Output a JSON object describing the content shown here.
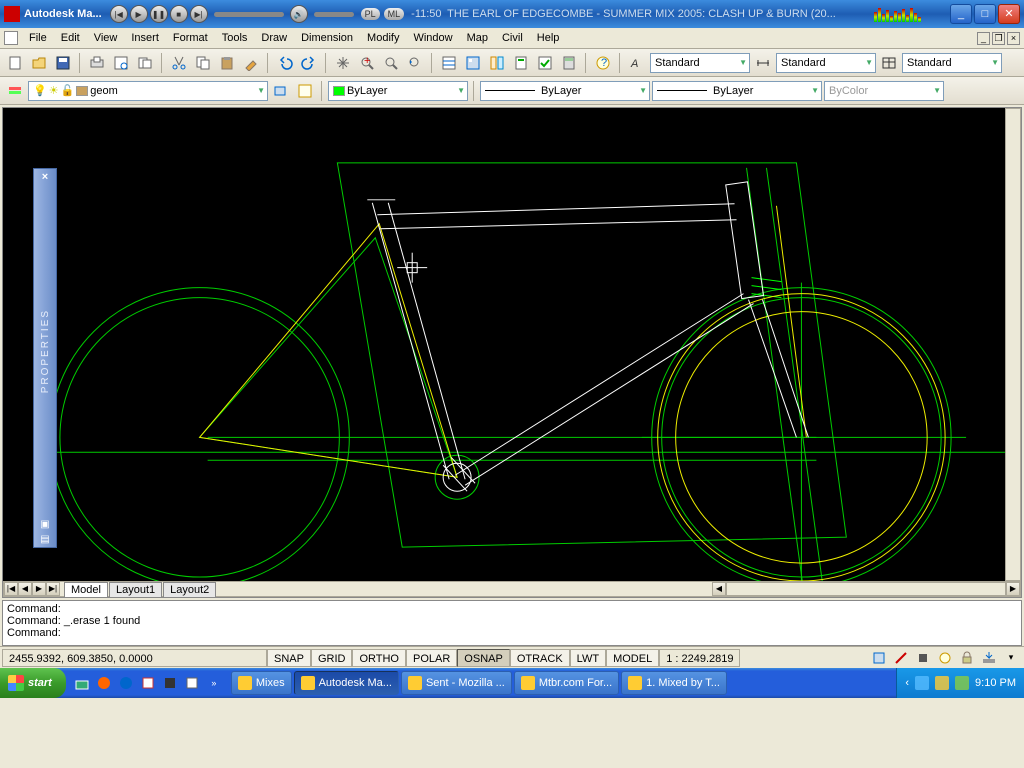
{
  "titlebar": {
    "app_name": "Autodesk Ma...",
    "track_time": "-11:50",
    "track_info": "THE EARL OF EDGECOMBE - SUMMER MIX 2005: CLASH UP & BURN (20...",
    "pill1": "PL",
    "pill2": "ML"
  },
  "menus": [
    "File",
    "Edit",
    "View",
    "Insert",
    "Format",
    "Tools",
    "Draw",
    "Dimension",
    "Modify",
    "Window",
    "Map",
    "Civil",
    "Help"
  ],
  "layer": {
    "current": "geom",
    "color_combo": "ByLayer",
    "linetype_combo": "ByLayer",
    "lineweight_combo": "ByLayer",
    "plotstyle_combo": "ByColor"
  },
  "styles": {
    "text_style": "Standard",
    "dim_style": "Standard",
    "table_style": "Standard"
  },
  "properties_panel": {
    "label": "PROPERTIES"
  },
  "tabs": [
    "Model",
    "Layout1",
    "Layout2"
  ],
  "command": {
    "line1": "Command:",
    "line2": "Command: _.erase 1 found",
    "line3": "Command:"
  },
  "status": {
    "coords": "2455.9392, 609.3850, 0.0000",
    "toggles": [
      "SNAP",
      "GRID",
      "ORTHO",
      "POLAR",
      "OSNAP",
      "OTRACK",
      "LWT",
      "MODEL"
    ],
    "active_toggle": "OSNAP",
    "scale": "1 : 2249.2819"
  },
  "taskbar": {
    "start": "start",
    "tasks": [
      {
        "label": "Mixes",
        "active": false
      },
      {
        "label": "Autodesk Ma...",
        "active": true
      },
      {
        "label": "Sent - Mozilla ...",
        "active": false
      },
      {
        "label": "Mtbr.com For...",
        "active": false
      },
      {
        "label": "1. Mixed by T...",
        "active": false
      }
    ],
    "clock": "9:10 PM"
  }
}
